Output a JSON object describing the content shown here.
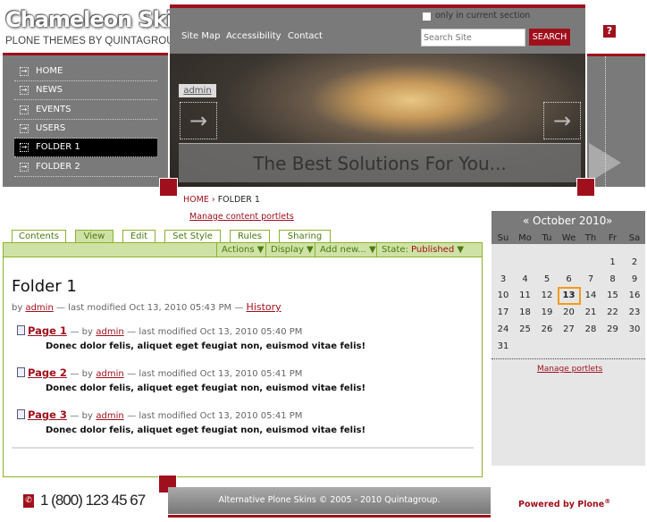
{
  "logo": {
    "title": "Chameleon Skin",
    "subtitle": "PLONE THEMES BY QUINTAGROUP"
  },
  "nav": {
    "items": [
      {
        "label": "HOME"
      },
      {
        "label": "NEWS"
      },
      {
        "label": "EVENTS"
      },
      {
        "label": "USERS"
      },
      {
        "label": "FOLDER 1",
        "active": true
      },
      {
        "label": "FOLDER 2"
      }
    ]
  },
  "site_actions": [
    "Site Map",
    "Accessibility",
    "Contact"
  ],
  "search": {
    "only_current_label": "only in current section",
    "placeholder": "Search Site",
    "button": "SEARCH"
  },
  "help_icon": "?",
  "hero": {
    "user_tab": "admin",
    "caption": "The Best Solutions For You..."
  },
  "breadcrumb": {
    "home": "HOME",
    "separator": "›",
    "current": "FOLDER 1"
  },
  "manage_content_portlets": "Manage content portlets",
  "tabs": [
    {
      "label": "Contents"
    },
    {
      "label": "View",
      "selected": true
    },
    {
      "label": "Edit"
    },
    {
      "label": "Set Style"
    },
    {
      "label": "Rules"
    },
    {
      "label": "Sharing"
    }
  ],
  "actions": {
    "actions": "Actions ▼",
    "display": "Display ▼",
    "add_new": "Add new... ▼",
    "state_label": "State:",
    "state_value": "Published",
    "state_arrow": "▼"
  },
  "document": {
    "title": "Folder 1",
    "by": "by",
    "author": "admin",
    "modified": "— last modified Oct 13, 2010 05:43 PM —",
    "history": "History"
  },
  "items": [
    {
      "title": "Page 1",
      "by": "— by",
      "author": "admin",
      "modified": "— last modified Oct 13, 2010 05:40 PM",
      "description": "Donec dolor felis, aliquet eget feugiat non, euismod vitae felis!"
    },
    {
      "title": "Page 2",
      "by": "— by",
      "author": "admin",
      "modified": "— last modified Oct 13, 2010 05:41 PM",
      "description": "Donec dolor felis, aliquet eget feugiat non, euismod vitae felis!"
    },
    {
      "title": "Page 3",
      "by": "— by",
      "author": "admin",
      "modified": "— last modified Oct 13, 2010 05:41 PM",
      "description": "Donec dolor felis, aliquet eget feugiat non, euismod vitae felis!"
    }
  ],
  "calendar": {
    "prev": "«",
    "month": "October 2010",
    "next": "»",
    "days": [
      "Su",
      "Mo",
      "Tu",
      "We",
      "Th",
      "Fr",
      "Sa"
    ],
    "first_weekday": 5,
    "num_days": 31,
    "today": 13,
    "manage": "Manage portlets"
  },
  "footer": {
    "phone": "1 (800) 123 45 67",
    "copyright": "Alternative Plone Skins © 2005 - 2010 Quintagroup.",
    "powered_by": "Powered by Plone",
    "reg": "®"
  },
  "colors": {
    "accent": "#a0101c",
    "gray": "#7a7a7a",
    "green": "#8bb22a",
    "green_light": "#cfe2a6",
    "today_border": "#f39a1a"
  }
}
